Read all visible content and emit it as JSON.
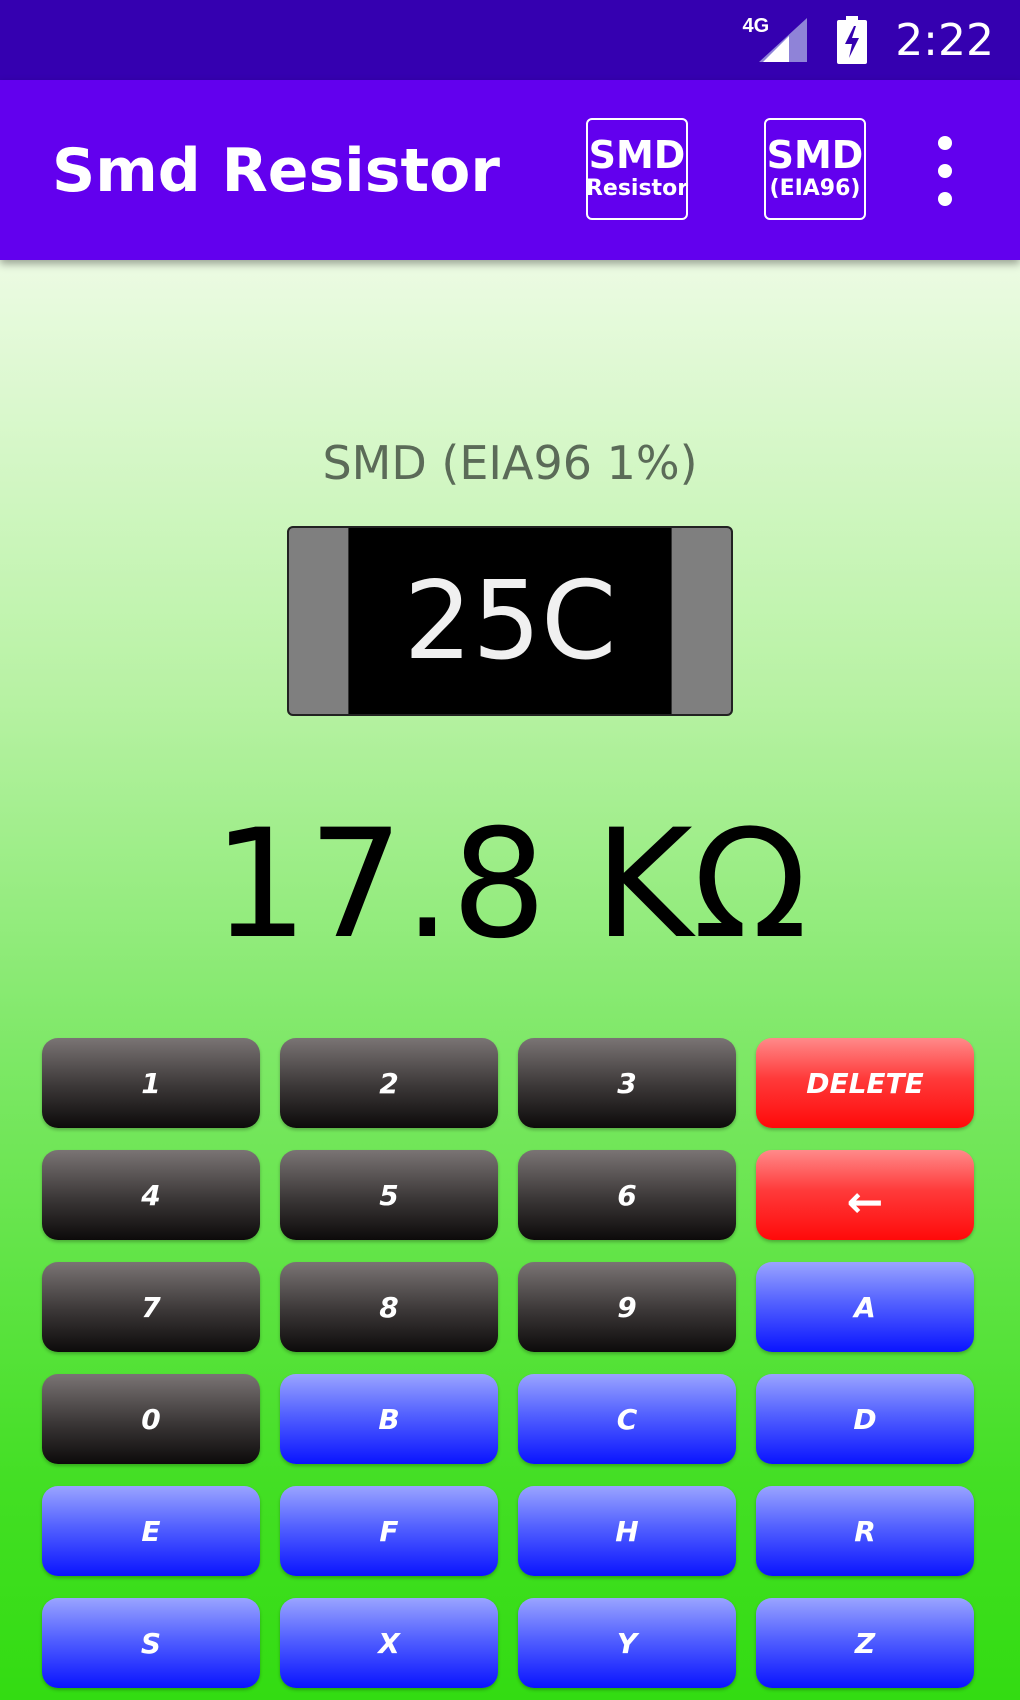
{
  "status_bar": {
    "network": "4G",
    "time": "2:22"
  },
  "app_bar": {
    "title": "Smd Resistor",
    "btn_smd_resistor": {
      "line1": "SMD",
      "line2": "Resistor"
    },
    "btn_smd_eia96": {
      "line1": "SMD",
      "line2": "(EIA96)"
    }
  },
  "main": {
    "mode_label": "SMD (EIA96 1%)",
    "chip_code": "25C",
    "result": "17.8 KΩ"
  },
  "keypad": {
    "keys": [
      "1",
      "2",
      "3",
      "DELETE",
      "4",
      "5",
      "6",
      "←",
      "7",
      "8",
      "9",
      "A",
      "0",
      "B",
      "C",
      "D",
      "E",
      "F",
      "H",
      "R",
      "S",
      "X",
      "Y",
      "Z"
    ]
  },
  "colors": {
    "status_bar": "#3500b0",
    "app_bar": "#6200ee",
    "digit_key": "#3a3636",
    "delete_key": "#ff3a3a",
    "letter_key": "#5361ff"
  }
}
